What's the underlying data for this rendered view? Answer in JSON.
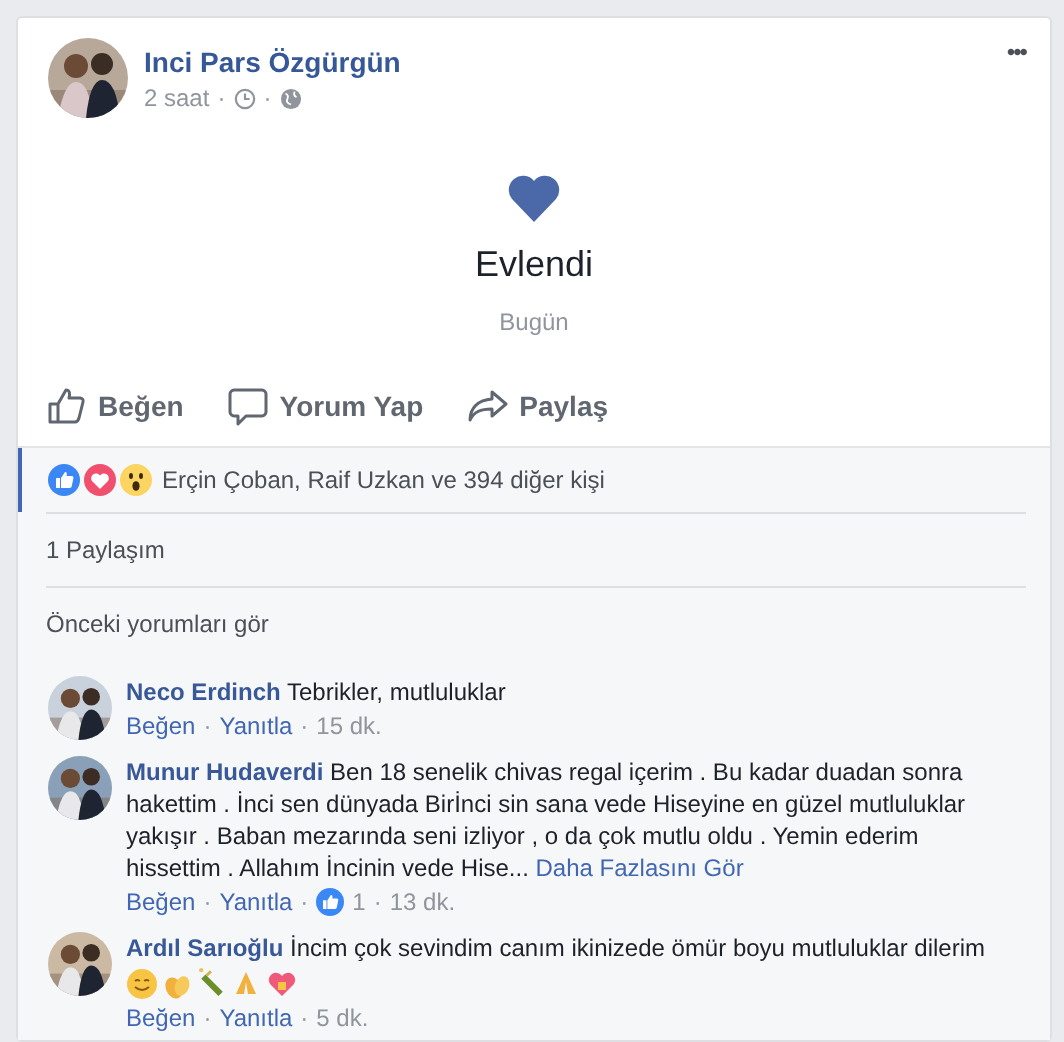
{
  "post": {
    "author": "Inci Pars Özgürgün",
    "time": "2 saat",
    "separator": "·",
    "more": "•••"
  },
  "event": {
    "title": "Evlendi",
    "date": "Bugün"
  },
  "actions": [
    {
      "kind": "like",
      "label": "Beğen"
    },
    {
      "kind": "comment",
      "label": "Yorum Yap"
    },
    {
      "kind": "share",
      "label": "Paylaş"
    }
  ],
  "reactions": {
    "text": "Erçin Çoban, Raif Uzkan ve 394 diğer kişi"
  },
  "shares": "1 Paylaşım",
  "previous_comments": "Önceki yorumları gör",
  "comments": [
    {
      "author": "Neco Erdinch",
      "text": "Tebrikler, mutluluklar",
      "actions": [
        "Beğen",
        "Yanıtla"
      ],
      "time": "15 dk."
    },
    {
      "author": "Munur Hudaverdi",
      "text": "Ben 18 senelik chivas regal içerim . Bu kadar duadan sonra hakettim . İnci sen dünyada Birİnci sin sana vede Hiseyine en güzel mutluluklar yakışır . Baban mezarında seni izliyor , o da çok mutlu oldu . Yemin ederim hissettim . Allahım İncinin vede Hise...",
      "more": "Daha Fazlasını Gör",
      "actions": [
        "Beğen",
        "Yanıtla"
      ],
      "likes": "1",
      "time": "13 dk."
    },
    {
      "author": "Ardıl Sarıoğlu",
      "text": "İncim çok sevindim canım ikinizede ömür boyu mutluluklar dilerim",
      "emoji": true,
      "actions": [
        "Beğen",
        "Yanıtla"
      ],
      "time": "5 dk."
    }
  ]
}
